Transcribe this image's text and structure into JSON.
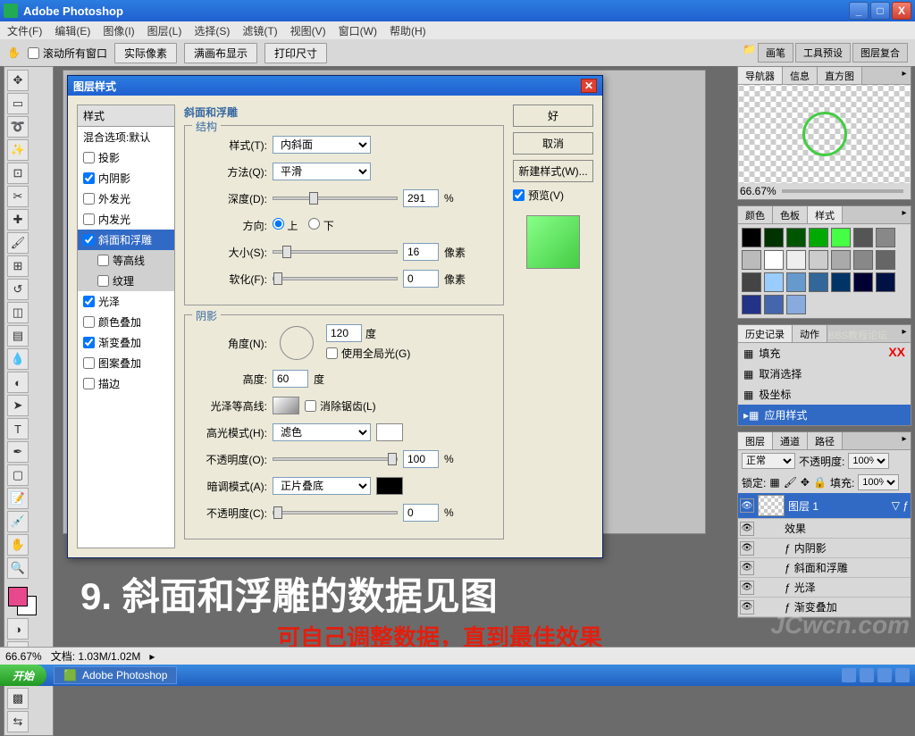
{
  "window": {
    "title": "Adobe Photoshop"
  },
  "winbtns": {
    "min": "_",
    "max": "□",
    "close": "X"
  },
  "menus": [
    "文件(F)",
    "编辑(E)",
    "图像(I)",
    "图层(L)",
    "选择(S)",
    "滤镜(T)",
    "视图(V)",
    "窗口(W)",
    "帮助(H)"
  ],
  "optionbar": {
    "scroll_all": "滚动所有窗口",
    "actual_px": "实际像素",
    "fit_screen": "满画布显示",
    "print_size": "打印尺寸",
    "tabs": [
      "画笔",
      "工具预设",
      "图层复合"
    ]
  },
  "dialog": {
    "title": "图层样式",
    "styles_head": "样式",
    "blend_default": "混合选项:默认",
    "fx": {
      "dropshadow": "投影",
      "innershadow": "内阴影",
      "outerglow": "外发光",
      "innerglow": "内发光",
      "bevel": "斜面和浮雕",
      "contour": "等高线",
      "texture": "纹理",
      "satin": "光泽",
      "coloroverlay": "颜色叠加",
      "gradientoverlay": "渐变叠加",
      "patternoverlay": "图案叠加",
      "stroke": "描边"
    },
    "sect_bevel": "斜面和浮雕",
    "sect_struct": "结构",
    "style_lbl": "样式(T):",
    "style_val": "内斜面",
    "method_lbl": "方法(Q):",
    "method_val": "平滑",
    "depth_lbl": "深度(D):",
    "depth_val": "291",
    "pct": "%",
    "dir_lbl": "方向:",
    "dir_up": "上",
    "dir_down": "下",
    "size_lbl": "大小(S):",
    "size_val": "16",
    "px": "像素",
    "soften_lbl": "软化(F):",
    "soften_val": "0",
    "sect_shade": "阴影",
    "angle_lbl": "角度(N):",
    "angle_val": "120",
    "deg": "度",
    "global": "使用全局光(G)",
    "alt_lbl": "高度:",
    "alt_val": "60",
    "gloss_lbl": "光泽等高线:",
    "antialias": "消除锯齿(L)",
    "hlmode_lbl": "高光模式(H):",
    "hlmode_val": "滤色",
    "opacity_lbl": "不透明度(O):",
    "hl_opacity": "100",
    "shmode_lbl": "暗调模式(A):",
    "shmode_val": "正片叠底",
    "opacity2_lbl": "不透明度(C):",
    "sh_opacity": "0",
    "ok": "好",
    "cancel": "取消",
    "newstyle": "新建样式(W)...",
    "preview": "预览(V)"
  },
  "nav": {
    "tabs": [
      "导航器",
      "信息",
      "直方图"
    ],
    "zoom": "66.67%"
  },
  "color": {
    "tabs": [
      "颜色",
      "色板",
      "样式"
    ]
  },
  "swatches": [
    "#000",
    "#030",
    "#050",
    "#0a0",
    "#4f4",
    "#555",
    "#888",
    "#bbb",
    "#fff",
    "#eee",
    "#ccc",
    "#aaa",
    "#888",
    "#666",
    "#444",
    "#9cf",
    "#69c",
    "#369",
    "#036",
    "#003",
    "#014",
    "#238",
    "#46a",
    "#8ad"
  ],
  "history": {
    "tabs": [
      "历史记录",
      "动作"
    ],
    "watermark": "BBS教程论坛",
    "xx": "XX",
    "items": [
      "填充",
      "取消选择",
      "极坐标",
      "应用样式"
    ]
  },
  "layers": {
    "tabs": [
      "图层",
      "通道",
      "路径"
    ],
    "mode_lbl": "正常",
    "opacity_lbl": "不透明度:",
    "opacity": "100%",
    "lock_lbl": "锁定:",
    "fill_lbl": "填充:",
    "fill": "100%",
    "layer1": "图层 1",
    "fxlbl": "效果",
    "fx": [
      "内阴影",
      "斜面和浮雕",
      "光泽",
      "渐变叠加"
    ]
  },
  "annot": {
    "big": "9. 斜面和浮雕的数据见图",
    "red": "可自己调整数据，直到最佳效果"
  },
  "status": {
    "zoom": "66.67%",
    "doc": "文档: 1.03M/1.02M"
  },
  "taskbar": {
    "start": "开始",
    "app": "Adobe Photoshop"
  },
  "watermark": "JCwcn.com"
}
